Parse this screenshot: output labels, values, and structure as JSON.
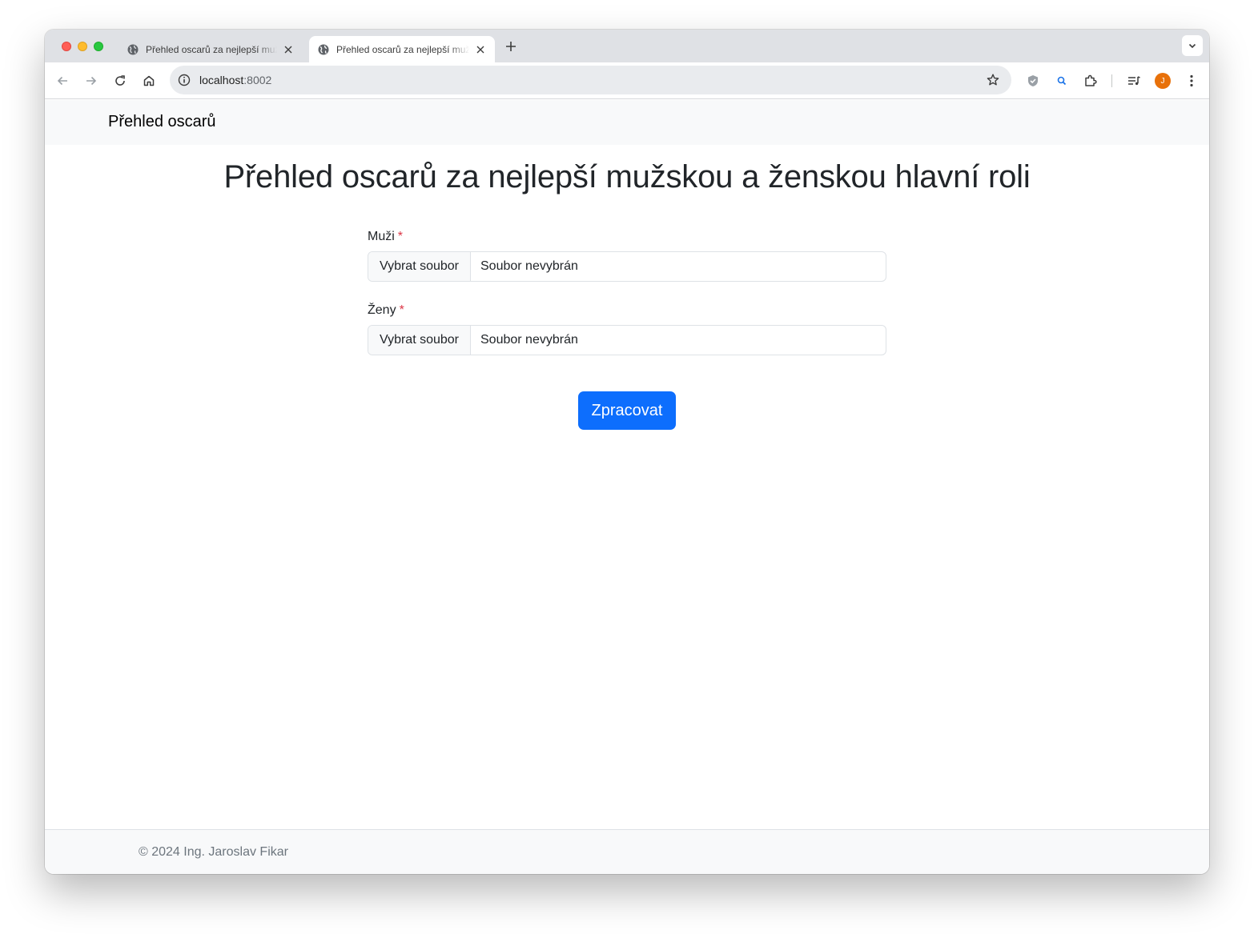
{
  "browser": {
    "tabs": [
      {
        "title": "Přehled oscarů za nejlepší mužskou a ženskou hlavní roli",
        "active": false
      },
      {
        "title": "Přehled oscarů za nejlepší mužskou a ženskou hlavní roli",
        "active": true
      }
    ],
    "address": {
      "host": "localhost",
      "port": ":8002"
    },
    "profile_initial": "J",
    "profile_color": "#e8710a"
  },
  "navbar": {
    "brand": "Přehled oscarů"
  },
  "main": {
    "title": "Přehled oscarů za nejlepší mužskou a ženskou hlavní roli",
    "fields": [
      {
        "label": "Muži",
        "required_mark": "*",
        "button_label": "Vybrat soubor",
        "file_status": "Soubor nevybrán"
      },
      {
        "label": "Ženy",
        "required_mark": "*",
        "button_label": "Vybrat soubor",
        "file_status": "Soubor nevybrán"
      }
    ],
    "submit_label": "Zpracovat"
  },
  "footer": {
    "text": "© 2024 Ing. Jaroslav Fikar"
  },
  "colors": {
    "primary": "#0d6efd",
    "required": "#dc3545",
    "navbar_bg": "#f8f9fa"
  }
}
